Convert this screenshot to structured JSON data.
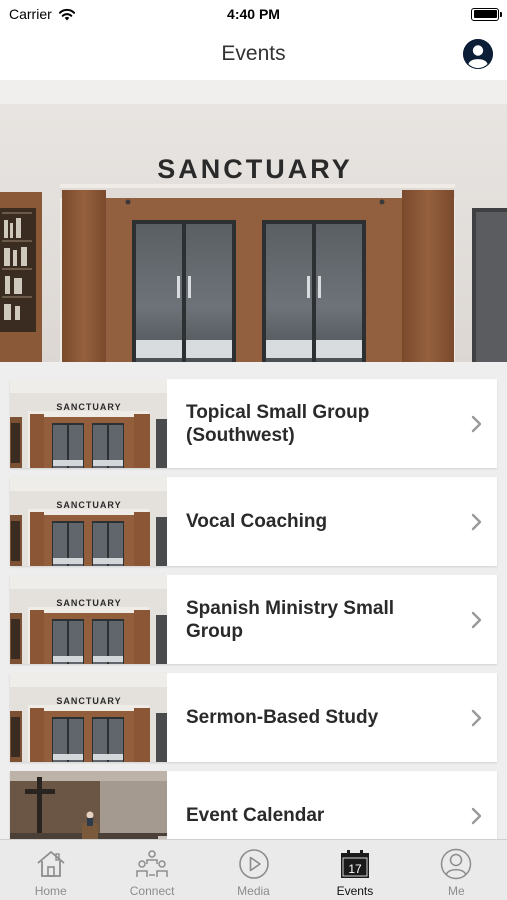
{
  "status_bar": {
    "carrier": "Carrier",
    "time": "4:40 PM"
  },
  "nav": {
    "title": "Events"
  },
  "hero": {
    "sign_text": "SANCTUARY"
  },
  "events": [
    {
      "title": "Topical Small Group (Southwest)",
      "image": "sanctuary",
      "thumb_text": "SANCTUARY"
    },
    {
      "title": "Vocal Coaching",
      "image": "sanctuary",
      "thumb_text": "SANCTUARY"
    },
    {
      "title": "Spanish Ministry Small Group",
      "image": "sanctuary",
      "thumb_text": "SANCTUARY"
    },
    {
      "title": "Sermon-Based Study",
      "image": "sanctuary",
      "thumb_text": "SANCTUARY"
    },
    {
      "title": "Event Calendar",
      "image": "stage-with-cross",
      "thumb_text": ""
    }
  ],
  "tabs": [
    {
      "label": "Home",
      "icon": "home-icon",
      "active": false
    },
    {
      "label": "Connect",
      "icon": "people-icon",
      "active": false
    },
    {
      "label": "Media",
      "icon": "play-icon",
      "active": false
    },
    {
      "label": "Events",
      "icon": "calendar-icon",
      "active": true,
      "badge": "17"
    },
    {
      "label": "Me",
      "icon": "person-icon",
      "active": false
    }
  ],
  "colors": {
    "accent": "#0b1e35",
    "tab_inactive": "#8c8c8c",
    "background": "#eeeeee"
  }
}
